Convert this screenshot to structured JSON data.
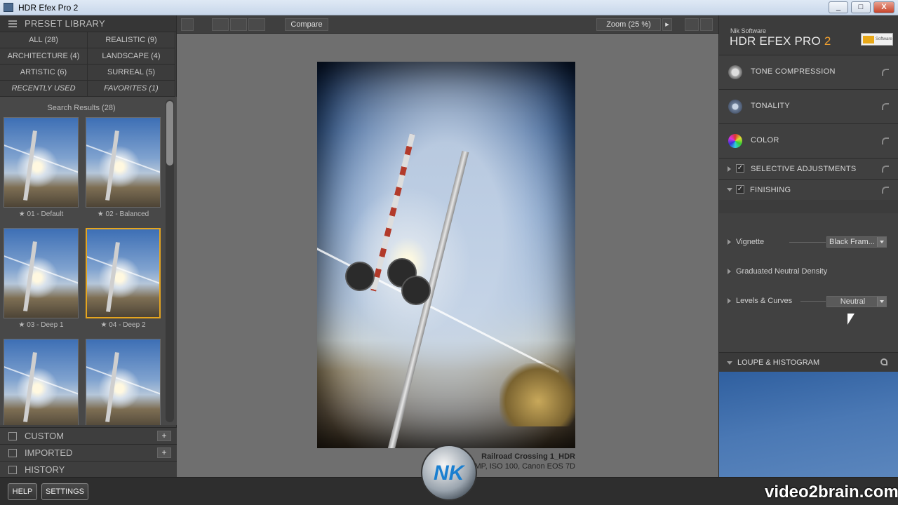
{
  "window": {
    "title": "HDR Efex Pro 2",
    "buttons": [
      "_",
      "□",
      "X"
    ]
  },
  "library": {
    "header": "PRESET LIBRARY",
    "categories": [
      "ALL (28)",
      "REALISTIC (9)",
      "ARCHITECTURE (4)",
      "LANDSCAPE (4)",
      "ARTISTIC (6)",
      "SURREAL (5)",
      "RECENTLY USED",
      "FAVORITES (1)"
    ],
    "results_label": "Search Results (28)",
    "presets": [
      {
        "label": "★ 01 - Default"
      },
      {
        "label": "★ 02 - Balanced"
      },
      {
        "label": "★ 03 - Deep 1"
      },
      {
        "label": "★ 04 - Deep 2"
      },
      {
        "label": ""
      },
      {
        "label": ""
      }
    ],
    "selected_preset_index": 3,
    "sections": {
      "custom": "CUSTOM",
      "imported": "IMPORTED",
      "history": "HISTORY"
    },
    "plus": "+"
  },
  "toolbar": {
    "compare": "Compare",
    "zoom": "Zoom (25 %)",
    "next": "▸"
  },
  "photo": {
    "name": "Railroad Crossing 1_HDR",
    "meta": "MP, ISO 100, Canon EOS 7D"
  },
  "right": {
    "brand_small": "Nik Software",
    "brand_main": "HDR EFEX PRO",
    "brand_version": "2",
    "logo_text": "Software",
    "panels": {
      "tone": "TONE COMPRESSION",
      "tonality": "TONALITY",
      "color": "COLOR",
      "selective": "SELECTIVE ADJUSTMENTS",
      "finishing": "FINISHING"
    },
    "finishing": {
      "vignette": {
        "label": "Vignette",
        "value": "Black Fram..."
      },
      "gnd": {
        "label": "Graduated Neutral Density"
      },
      "levels": {
        "label": "Levels & Curves",
        "value": "Neutral"
      }
    },
    "loupe": "LOUPE & HISTOGRAM",
    "checkmark": "✓"
  },
  "bottom": {
    "help": "HELP",
    "settings": "SETTINGS"
  },
  "watermark": {
    "text": "video2brain.com",
    "logo": "NK"
  },
  "colors": {
    "selected_border": "#e5a51f",
    "accent_version": "#f0a030"
  }
}
